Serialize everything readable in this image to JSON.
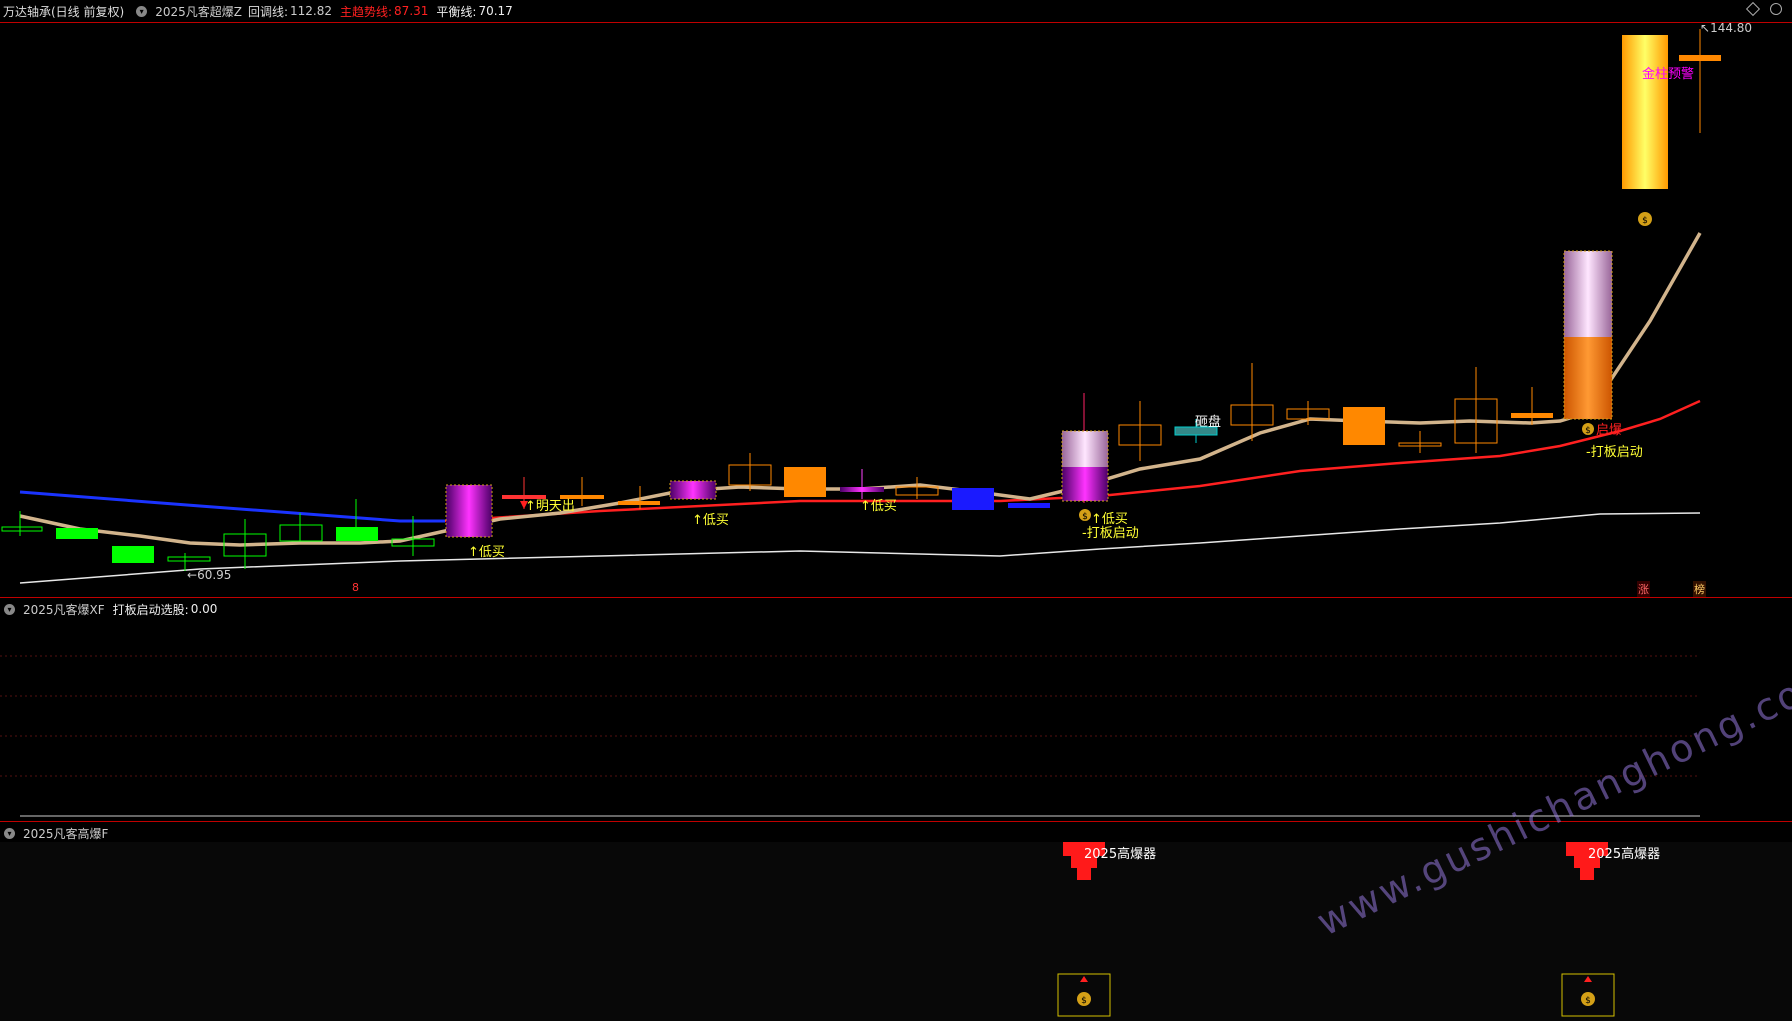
{
  "header": {
    "stock_title": "万达轴承(日线 前复权)",
    "indicator_name": "2025凡客超爆Z",
    "pullback_label": "回调线:",
    "pullback_value": "112.82",
    "main_trend_label": "主趋势线:",
    "main_trend_value": "87.31",
    "balance_label": "平衡线:",
    "balance_value": "70.17"
  },
  "price_panel": {
    "high_label": "144.80",
    "low_label": "60.95",
    "markers": {
      "low_buy": "↑低买",
      "tomorrow_sell": "↑明天出",
      "hit_board_start": "-打板启动",
      "smash": "砸盘",
      "launch": "启爆",
      "warning": "金柱预警"
    },
    "bottom_tags": [
      "涨",
      "榜"
    ],
    "volume_marker": "8"
  },
  "panel2": {
    "name": "2025凡客爆XF",
    "label": "打板启动选股:",
    "value": "0.00"
  },
  "panel3": {
    "name": "2025凡客高爆F",
    "signal_label": "2025高爆器"
  },
  "watermark": "www.gushichanghong.com",
  "colors": {
    "up": "#ff6633",
    "down": "#00ff00",
    "main_trend": "#ff2020",
    "balance": "#e8e8e8",
    "pullback": "#d2b48c",
    "blue_line": "#1a33ff",
    "panel_border": "#c00000"
  }
}
